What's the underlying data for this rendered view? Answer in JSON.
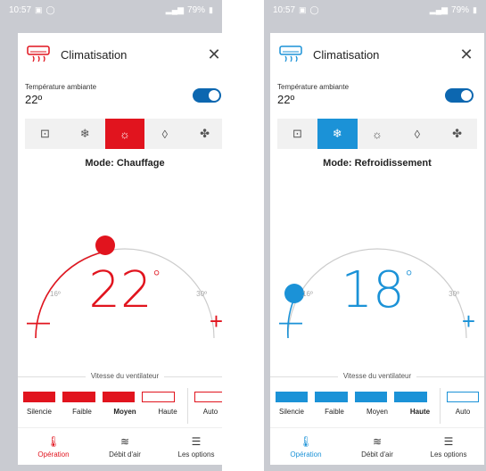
{
  "screens": [
    {
      "statusbar": {
        "time": "10:57",
        "battery": "79%"
      },
      "title": "Climatisation",
      "temp_label": "Température ambiante",
      "ambient_temp": "22º",
      "mode_label": "Mode: Chauffage",
      "setpoint": "22",
      "min": "16º",
      "max": "30º",
      "fan_title": "Vitesse du ventilateur",
      "fan_levels": [
        "Silencie",
        "Faible",
        "Moyen",
        "Haute",
        "Auto"
      ],
      "nav": [
        "Opération",
        "Débit d'air",
        "Les options"
      ],
      "accent": "#e1141e"
    },
    {
      "statusbar": {
        "time": "10:57",
        "battery": "79%"
      },
      "title": "Climatisation",
      "temp_label": "Température ambiante",
      "ambient_temp": "22º",
      "mode_label": "Mode: Refroidissement",
      "setpoint": "18",
      "min": "16º",
      "max": "30º",
      "fan_title": "Vitesse du ventilateur",
      "fan_levels": [
        "Silencie",
        "Faible",
        "Moyen",
        "Haute",
        "Auto"
      ],
      "nav": [
        "Opération",
        "Débit d'air",
        "Les options"
      ],
      "accent": "#1b92d7"
    }
  ]
}
